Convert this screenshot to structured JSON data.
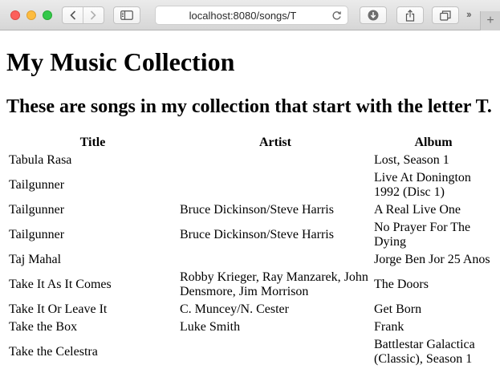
{
  "browser": {
    "url": "localhost:8080/songs/T",
    "more_label": "››",
    "new_tab_label": "+"
  },
  "page": {
    "heading": "My Music Collection",
    "subheading": "These are songs in my collection that start with the letter T."
  },
  "table": {
    "headers": [
      "Title",
      "Artist",
      "Album"
    ],
    "rows": [
      [
        "Tabula Rasa",
        "",
        "Lost, Season 1"
      ],
      [
        "Tailgunner",
        "",
        "Live At Donington 1992 (Disc 1)"
      ],
      [
        "Tailgunner",
        "Bruce Dickinson/Steve Harris",
        "A Real Live One"
      ],
      [
        "Tailgunner",
        "Bruce Dickinson/Steve Harris",
        "No Prayer For The Dying"
      ],
      [
        "Taj Mahal",
        "",
        "Jorge Ben Jor 25 Anos"
      ],
      [
        "Take It As It Comes",
        "Robby Krieger, Ray Manzarek, John Densmore, Jim Morrison",
        "The Doors"
      ],
      [
        "Take It Or Leave It",
        "C. Muncey/N. Cester",
        "Get Born"
      ],
      [
        "Take the Box",
        "Luke Smith",
        "Frank"
      ],
      [
        "Take the Celestra",
        "",
        "Battlestar Galactica (Classic), Season 1"
      ]
    ]
  }
}
